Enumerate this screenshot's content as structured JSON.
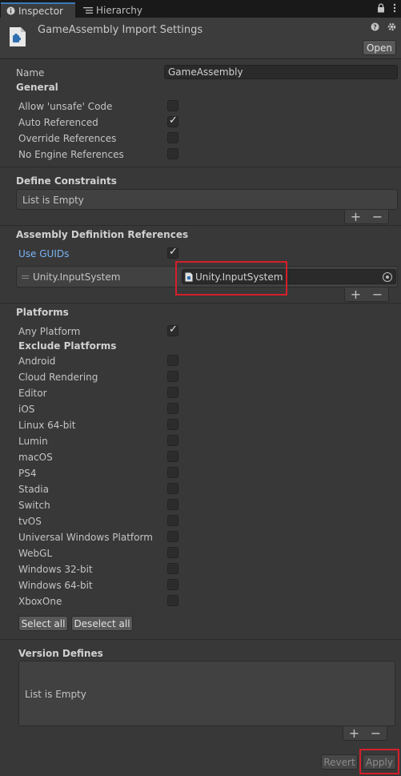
{
  "tabs": {
    "inspector": "Inspector",
    "hierarchy": "Hierarchy"
  },
  "header": {
    "title": "GameAssembly Import Settings",
    "open_label": "Open"
  },
  "name": {
    "label": "Name",
    "value": "GameAssembly"
  },
  "general": {
    "title": "General",
    "options": [
      {
        "label": "Allow 'unsafe' Code",
        "checked": false
      },
      {
        "label": "Auto Referenced",
        "checked": true
      },
      {
        "label": "Override References",
        "checked": false
      },
      {
        "label": "No Engine References",
        "checked": false
      }
    ]
  },
  "define_constraints": {
    "title": "Define Constraints",
    "empty_text": "List is Empty"
  },
  "assembly_refs": {
    "title": "Assembly Definition References",
    "use_guids_label": "Use GUIDs",
    "use_guids_checked": true,
    "item_label": "Unity.InputSystem",
    "item_value": "Unity.InputSystem"
  },
  "platforms": {
    "title": "Platforms",
    "any_platform_label": "Any Platform",
    "any_platform_checked": true,
    "exclude_title": "Exclude Platforms",
    "list": [
      "Android",
      "Cloud Rendering",
      "Editor",
      "iOS",
      "Linux 64-bit",
      "Lumin",
      "macOS",
      "PS4",
      "Stadia",
      "Switch",
      "tvOS",
      "Universal Windows Platform",
      "WebGL",
      "Windows 32-bit",
      "Windows 64-bit",
      "XboxOne"
    ],
    "select_all_label": "Select all",
    "deselect_all_label": "Deselect all"
  },
  "version_defines": {
    "title": "Version Defines",
    "empty_text": "List is Empty"
  },
  "footer": {
    "revert_label": "Revert",
    "apply_label": "Apply"
  },
  "colors": {
    "background": "#383838",
    "highlight_box": "#d51f2a",
    "link": "#7ab4f5"
  }
}
